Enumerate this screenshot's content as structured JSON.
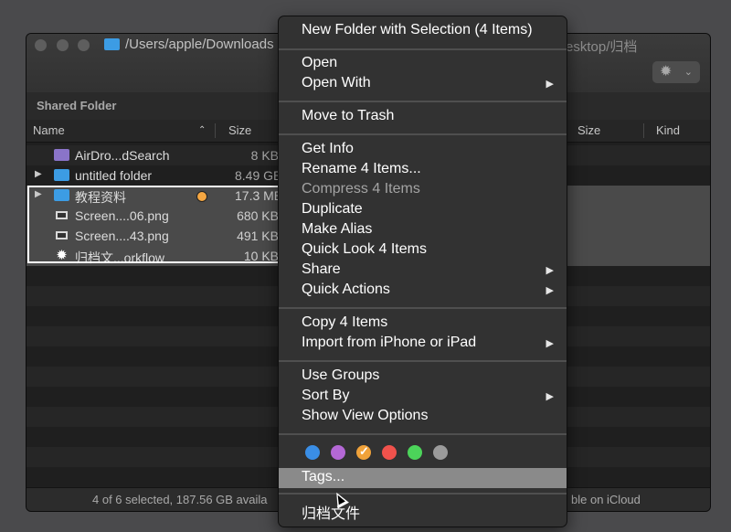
{
  "window": {
    "title_path": "/Users/apple/Downloads",
    "title_path_tail": "esktop/归档",
    "shared_folder_label": "Shared Folder",
    "columns": {
      "name": "Name",
      "size": "Size",
      "size_right": "Size",
      "kind": "Kind"
    },
    "files": [
      {
        "name": "AirDro...dSearch",
        "size": "8 KB",
        "icon": "app-folder-icon",
        "color": "#8a74c9",
        "disclosure": false,
        "selected": false
      },
      {
        "name": "untitled folder",
        "size": "8.49 GB",
        "icon": "folder-icon",
        "color": "#3c9ce4",
        "disclosure": true,
        "selected": false
      },
      {
        "name": "教程资料",
        "size": "17.3 MB",
        "icon": "folder-icon",
        "color": "#3c9ce4",
        "disclosure": true,
        "selected": true,
        "tag": "orange"
      },
      {
        "name": "Screen....06.png",
        "size": "680 KB",
        "icon": "screenshot-icon",
        "disclosure": false,
        "selected": true
      },
      {
        "name": "Screen....43.png",
        "size": "491 KB",
        "icon": "screenshot-icon",
        "disclosure": false,
        "selected": true
      },
      {
        "name": "归档文...orkflow",
        "size": "10 KB",
        "icon": "gear-icon",
        "disclosure": false,
        "selected": true
      }
    ],
    "status_left": "4 of 6 selected, 187.56 GB availa",
    "status_right": "ble on iCloud"
  },
  "context_menu": {
    "items": [
      {
        "label": "New Folder with Selection (4 Items)",
        "submenu": false
      },
      {
        "label": "Open",
        "submenu": false
      },
      {
        "label": "Open With",
        "submenu": true
      },
      {
        "label": "Move to Trash",
        "submenu": false
      },
      {
        "label": "Get Info",
        "submenu": false
      },
      {
        "label": "Rename 4 Items...",
        "submenu": false
      },
      {
        "label": "Compress 4 Items",
        "submenu": false,
        "disabled": true
      },
      {
        "label": "Duplicate",
        "submenu": false
      },
      {
        "label": "Make Alias",
        "submenu": false
      },
      {
        "label": "Quick Look 4 Items",
        "submenu": false
      },
      {
        "label": "Share",
        "submenu": true
      },
      {
        "label": "Quick Actions",
        "submenu": true
      },
      {
        "label": "Copy 4 Items",
        "submenu": false
      },
      {
        "label": "Import from iPhone or iPad",
        "submenu": true
      },
      {
        "label": "Use Groups",
        "submenu": false
      },
      {
        "label": "Sort By",
        "submenu": true
      },
      {
        "label": "Show View Options",
        "submenu": false
      },
      {
        "label": "Tags...",
        "submenu": false,
        "highlighted": true
      },
      {
        "label": "归档文件",
        "submenu": false
      }
    ],
    "tag_colors": [
      {
        "name": "blue",
        "hex": "#3a8ee6"
      },
      {
        "name": "purple",
        "hex": "#b468d6"
      },
      {
        "name": "orange",
        "hex": "#f0a23a",
        "checked": true
      },
      {
        "name": "red",
        "hex": "#f0524c"
      },
      {
        "name": "green",
        "hex": "#4cd45a"
      },
      {
        "name": "gray",
        "hex": "#9b9b9b"
      }
    ]
  }
}
